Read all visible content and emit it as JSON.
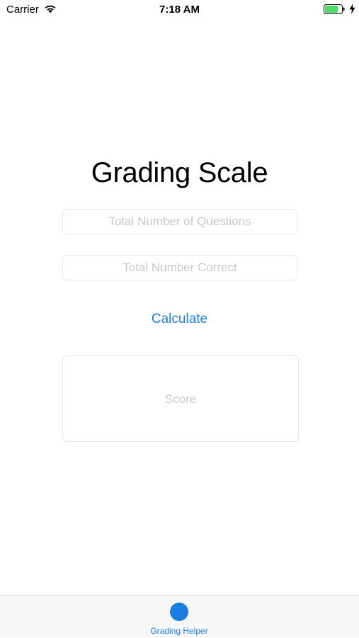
{
  "status_bar": {
    "carrier": "Carrier",
    "time": "7:18 AM",
    "wifi_icon": "wifi-icon",
    "battery_icon": "battery-icon",
    "charging_icon": "charging-bolt-icon",
    "battery_level_fraction": 0.8
  },
  "main": {
    "title": "Grading Scale",
    "questions_field": {
      "placeholder": "Total Number of Questions",
      "value": ""
    },
    "correct_field": {
      "placeholder": "Total Number Correct",
      "value": ""
    },
    "calculate_label": "Calculate",
    "score_placeholder": "Score"
  },
  "tab_bar": {
    "items": [
      {
        "label": "Grading Helper",
        "icon": "circle-icon",
        "selected": true
      }
    ]
  },
  "colors": {
    "accent": "#1a7ee0",
    "placeholder": "#c7c7cd",
    "battery_fill": "#4cd964"
  }
}
